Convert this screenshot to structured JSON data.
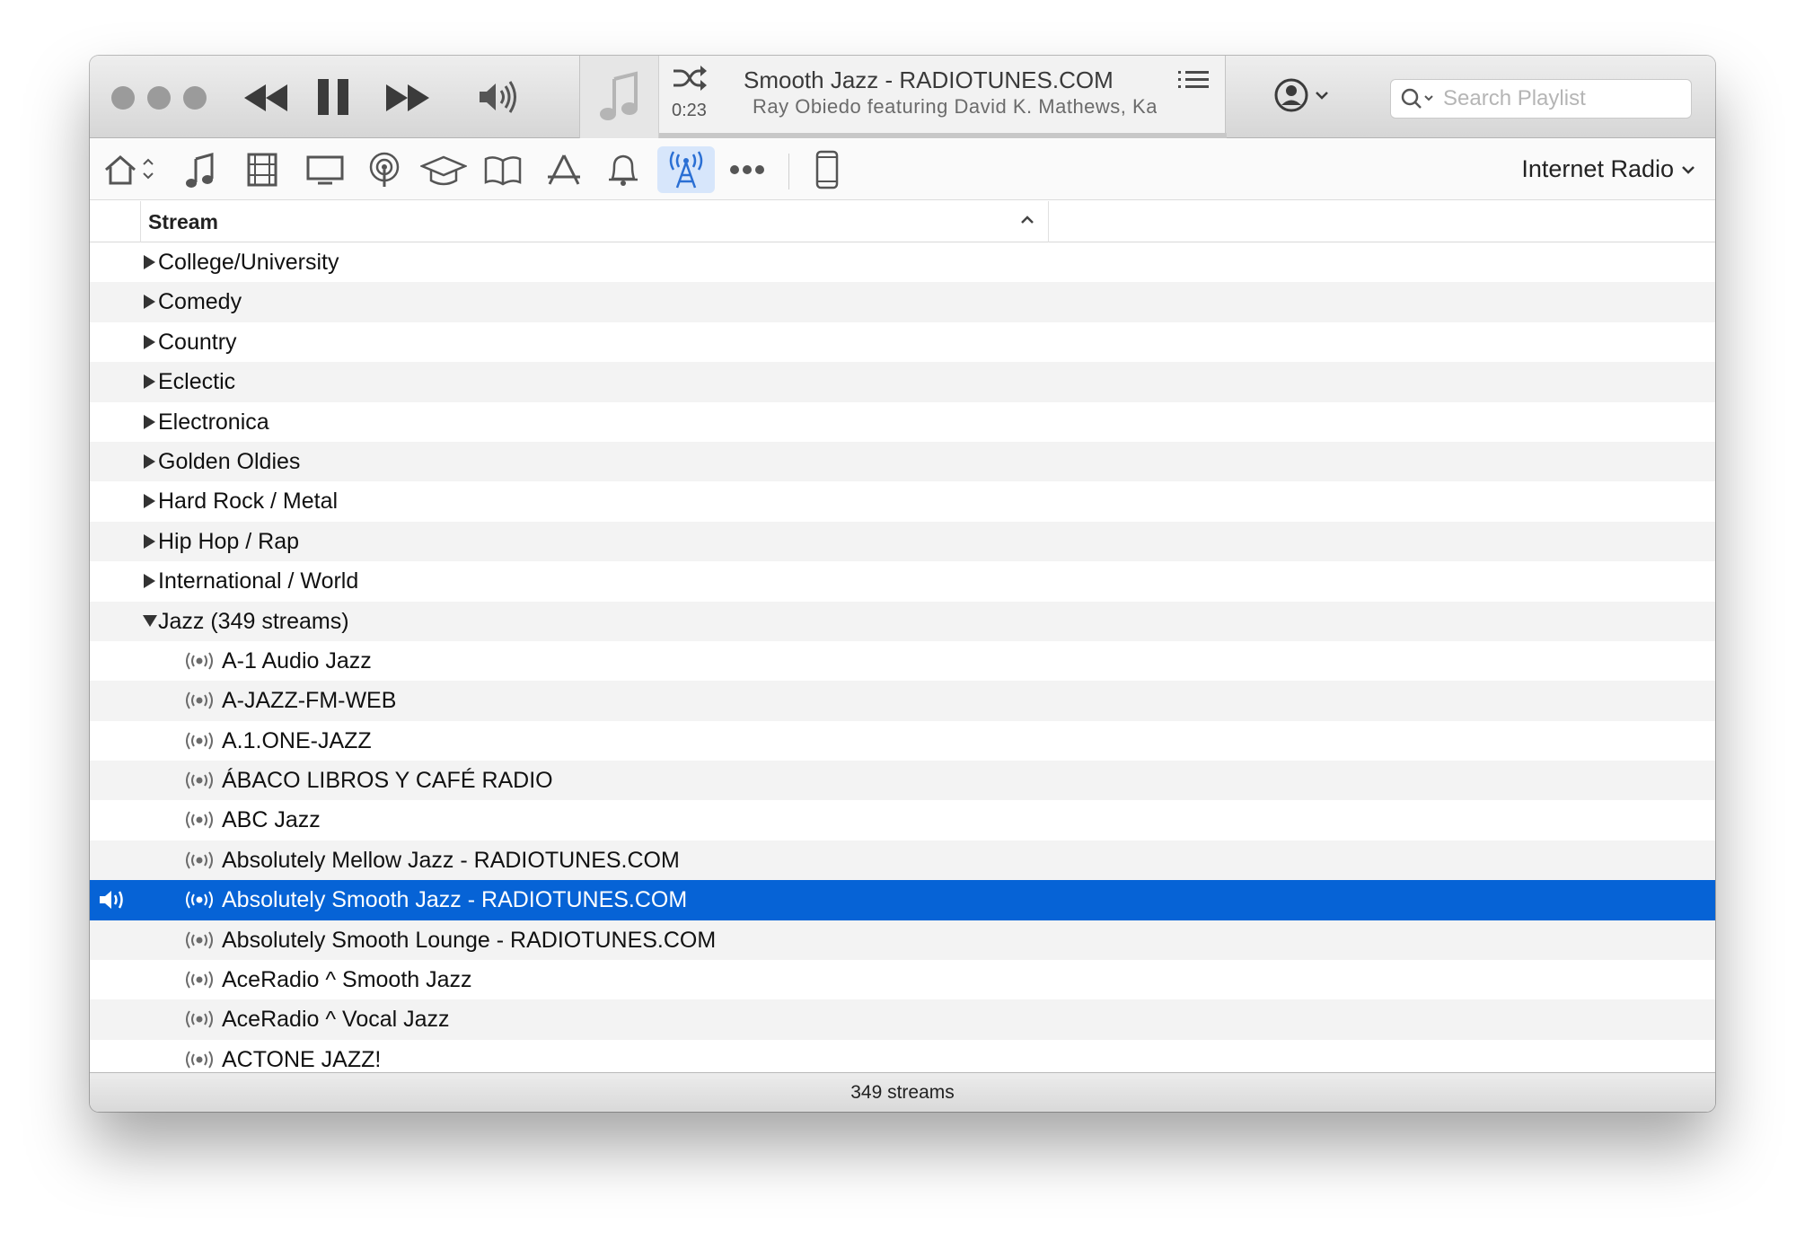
{
  "player": {
    "elapsed": "0:23",
    "now_playing_title": "Smooth Jazz - RADIOTUNES.COM",
    "now_playing_subtitle": "Ray Obiedo featuring David K. Mathews, Ka"
  },
  "search": {
    "placeholder": "Search Playlist"
  },
  "mediabar": {
    "source": "Internet Radio",
    "items": [
      "home-icon",
      "music-note-icon",
      "film-icon",
      "tv-icon",
      "podcast-icon",
      "graduation-cap-icon",
      "book-icon",
      "app-store-icon",
      "bell-icon",
      "radio-tower-icon",
      "more-icon",
      "iphone-icon"
    ],
    "active_item": "radio-tower-icon"
  },
  "table": {
    "column_header": "Stream",
    "categories": [
      {
        "label": "College/University"
      },
      {
        "label": "Comedy"
      },
      {
        "label": "Country"
      },
      {
        "label": "Eclectic"
      },
      {
        "label": "Electronica"
      },
      {
        "label": "Golden Oldies"
      },
      {
        "label": "Hard Rock / Metal"
      },
      {
        "label": "Hip Hop / Rap"
      },
      {
        "label": "International / World"
      },
      {
        "label": "Jazz (349 streams)"
      }
    ],
    "streams": [
      {
        "label": "A-1 Audio Jazz"
      },
      {
        "label": "A-JAZZ-FM-WEB"
      },
      {
        "label": "A.1.ONE-JAZZ"
      },
      {
        "label": "ÁBACO LIBROS Y CAFÉ RADIO"
      },
      {
        "label": "ABC Jazz"
      },
      {
        "label": "Absolutely Mellow Jazz - RADIOTUNES.COM"
      },
      {
        "label": "Absolutely Smooth Jazz - RADIOTUNES.COM"
      },
      {
        "label": "Absolutely Smooth Lounge - RADIOTUNES.COM"
      },
      {
        "label": "AceRadio ^ Smooth Jazz"
      },
      {
        "label": "AceRadio ^ Vocal Jazz"
      },
      {
        "label": "ACTONE JAZZ!"
      }
    ],
    "selected_stream": "Absolutely Smooth Jazz - RADIOTUNES.COM"
  },
  "status": {
    "text": "349 streams"
  },
  "colors": {
    "selection": "#0663d6",
    "active_tab_bg": "#d7e6fb",
    "icon_gray": "#6b6b6b",
    "icon_blue": "#2a6fd4"
  }
}
